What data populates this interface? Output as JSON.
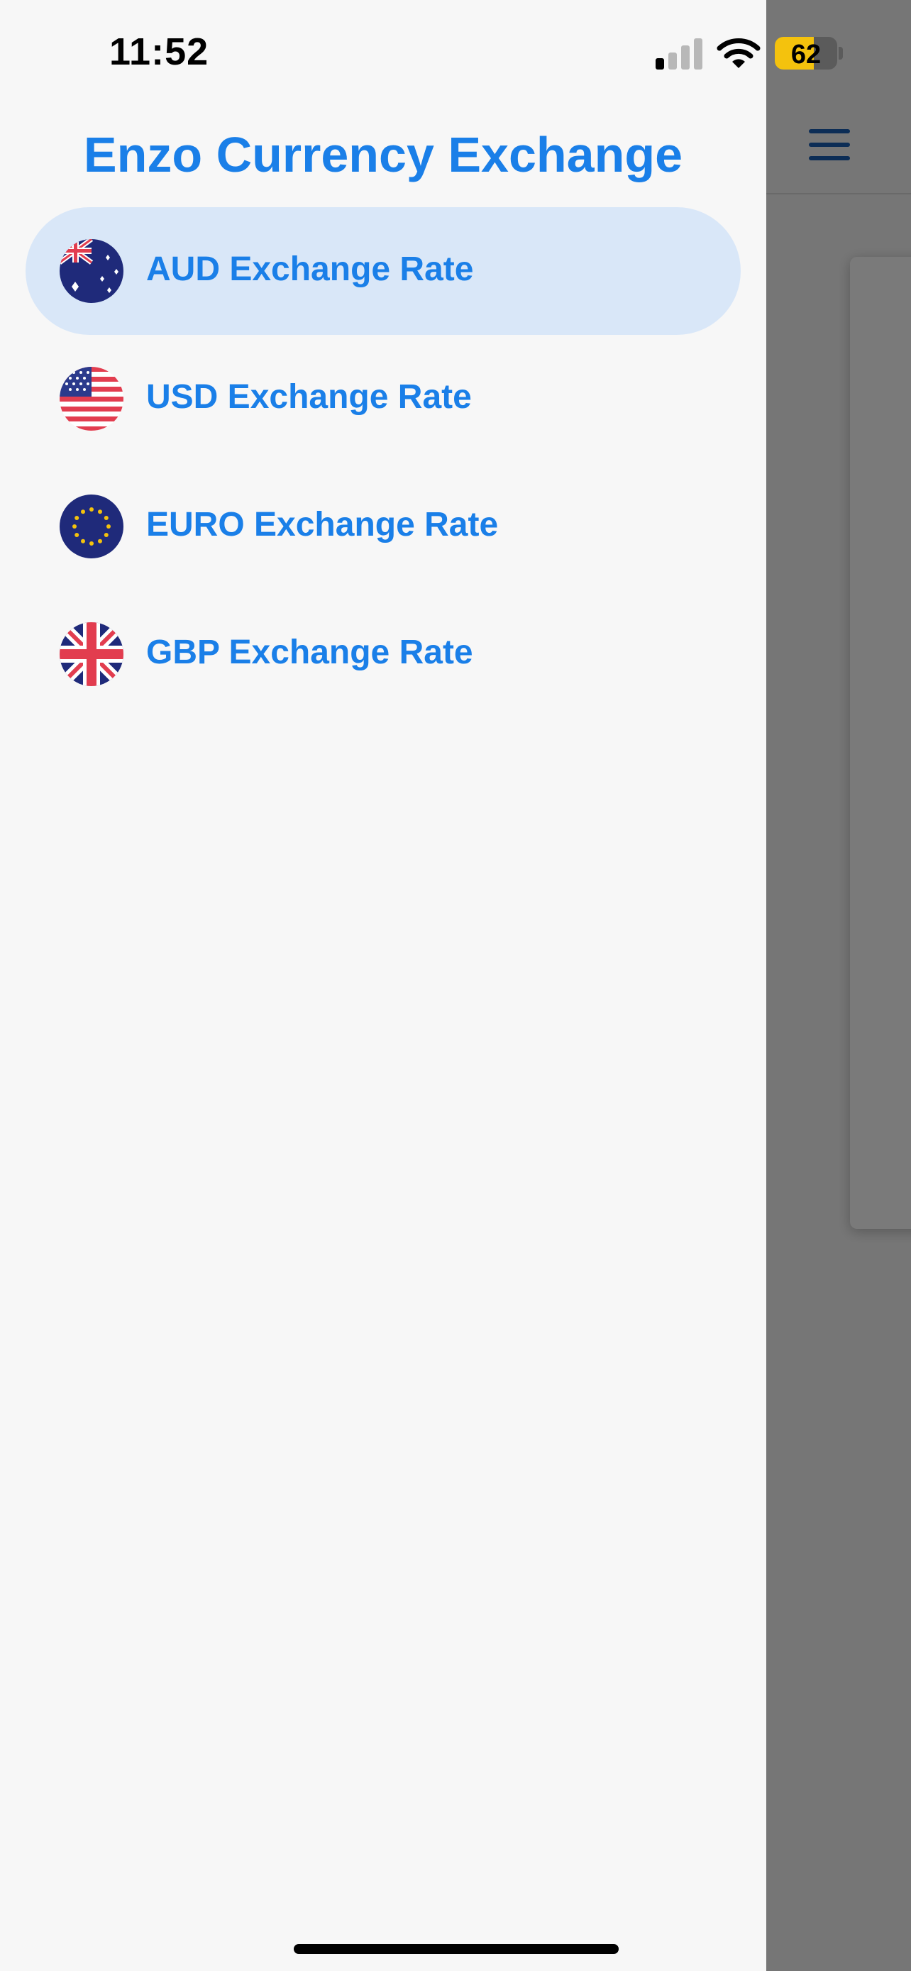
{
  "status_bar": {
    "time": "11:52",
    "battery_level": "62",
    "battery_percent": 62,
    "signal_bars_active": 1,
    "signal_bars_total": 4
  },
  "drawer": {
    "title": "Enzo Currency Exchange",
    "items": [
      {
        "label": "AUD Exchange Rate",
        "icon": "australia-flag-icon",
        "selected": true
      },
      {
        "label": "USD Exchange Rate",
        "icon": "usa-flag-icon",
        "selected": false
      },
      {
        "label": "EURO Exchange Rate",
        "icon": "eu-flag-icon",
        "selected": false
      },
      {
        "label": "GBP Exchange Rate",
        "icon": "uk-flag-icon",
        "selected": false
      }
    ]
  },
  "app": {
    "menu_icon": "hamburger-menu-icon"
  },
  "colors": {
    "accent": "#1a7fe8",
    "selected_bg": "#d9e7f8",
    "drawer_bg": "#f7f7f7",
    "battery": "#f4c20d"
  }
}
